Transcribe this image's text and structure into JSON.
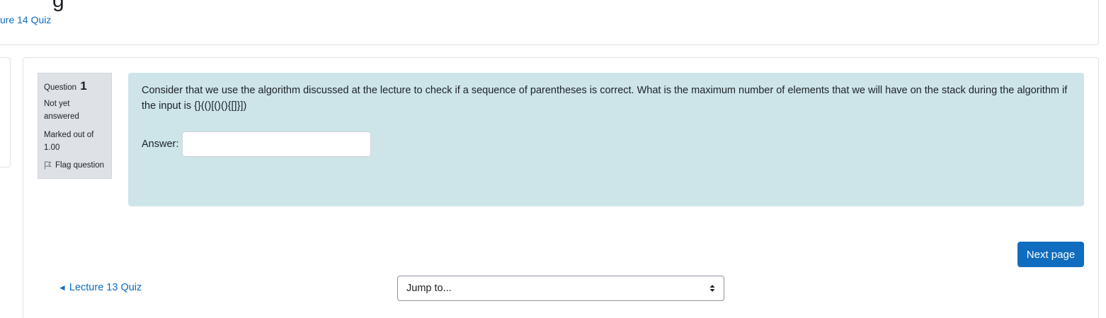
{
  "header": {
    "title_fragment": "g",
    "breadcrumb_link": "ure 14 Quiz"
  },
  "question": {
    "label": "Question",
    "number": "1",
    "state": "Not yet answered",
    "grade": "Marked out of 1.00",
    "flag_label": "Flag question",
    "text": "Consider that we use the algorithm discussed at the lecture to check if a sequence of parentheses is correct. What is the maximum number of elements that we will have on the stack during the algorithm if the input is {}(()[()(){[]}])",
    "answer_label": "Answer:",
    "answer_value": ""
  },
  "navigation": {
    "next_label": "Next page",
    "prev_arrow": "◄",
    "prev_link": "Lecture 13 Quiz",
    "jump_placeholder": "Jump to..."
  },
  "colors": {
    "accent": "#0f6cbf",
    "question_bg": "#cde5e9",
    "info_bg": "#dee2e6"
  }
}
